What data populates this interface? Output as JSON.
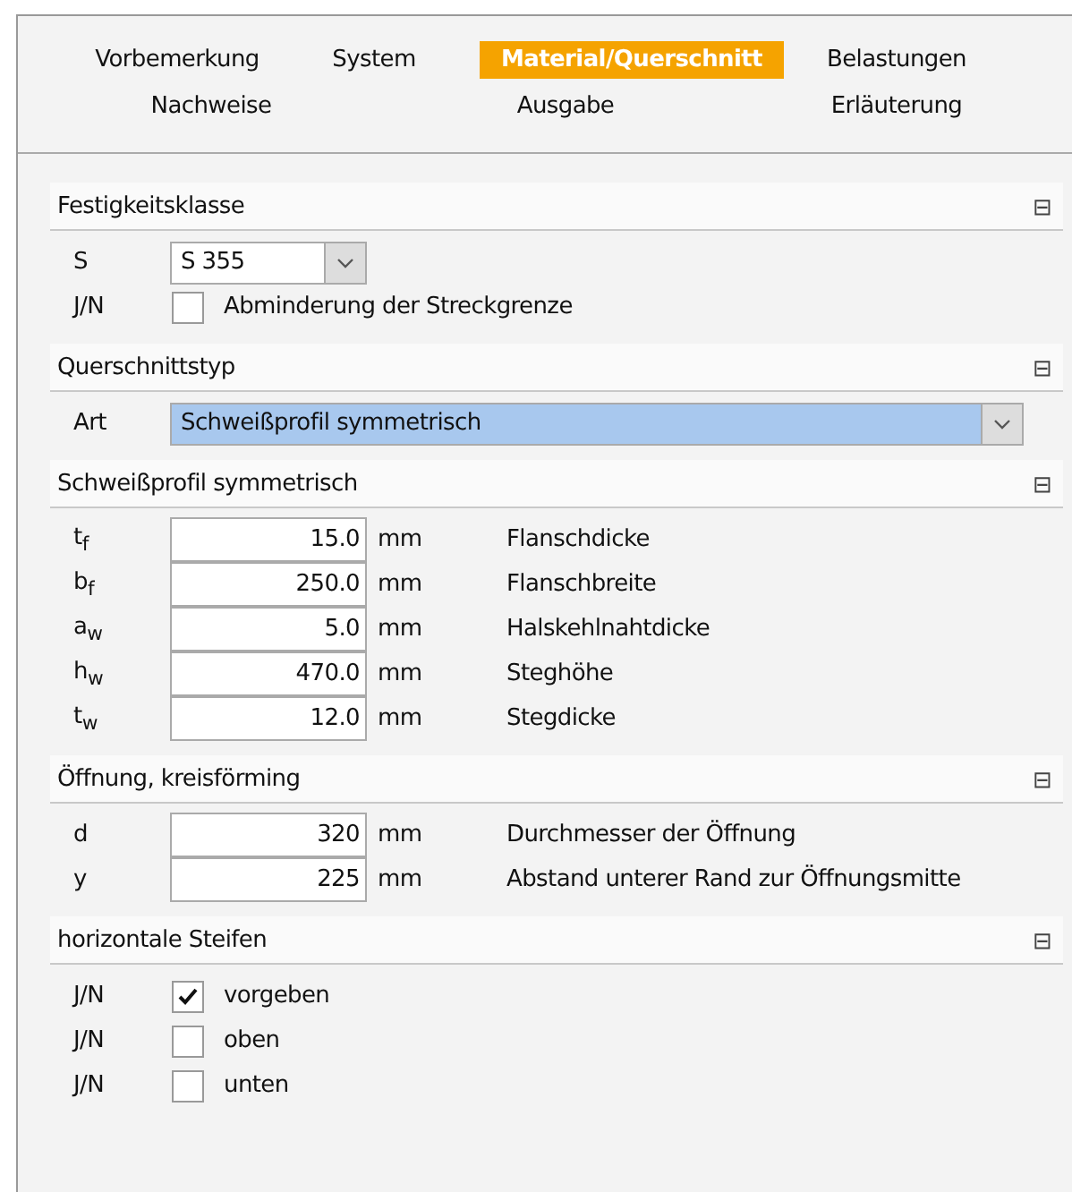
{
  "tabs": [
    [
      {
        "label": "Vorbemerkung",
        "selected": false
      },
      {
        "label": "System",
        "selected": false
      },
      {
        "label": "Material/Querschnitt",
        "selected": true
      },
      {
        "label": "Belastungen",
        "selected": false
      }
    ],
    [
      {
        "label": "Nachweise",
        "selected": false
      },
      {
        "label": "Ausgabe",
        "selected": false
      },
      {
        "label": "Erläuterung",
        "selected": false
      }
    ]
  ],
  "sections": [
    {
      "title": "Festigkeitsklasse",
      "collapse_icon": "⊟",
      "rows": [
        {
          "kind": "select",
          "label": "S",
          "value": "S 355",
          "wide": false
        },
        {
          "kind": "checkbox",
          "label": "J/N",
          "checked": false,
          "text": "Abminderung der Streckgrenze"
        }
      ]
    },
    {
      "title": "Querschnittstyp",
      "collapse_icon": "⊟",
      "rows": [
        {
          "kind": "select",
          "label": "Art",
          "value": "Schweißprofil symmetrisch",
          "wide": true
        }
      ]
    },
    {
      "title": "Schweißprofil symmetrisch",
      "collapse_icon": "⊟",
      "rows": [
        {
          "kind": "number",
          "label": "t$_{f}$",
          "value": "15.0",
          "unit": "mm",
          "text": "Flanschdicke"
        },
        {
          "kind": "number",
          "label": "b$_{f}$",
          "value": "250.0",
          "unit": "mm",
          "text": "Flanschbreite"
        },
        {
          "kind": "number",
          "label": "a$_{w}$",
          "value": "5.0",
          "unit": "mm",
          "text": "Halskehlnahtdicke"
        },
        {
          "kind": "number",
          "label": "h$_{w}$",
          "value": "470.0",
          "unit": "mm",
          "text": "Steghöhe"
        },
        {
          "kind": "number",
          "label": "t$_{w}$",
          "value": "12.0",
          "unit": "mm",
          "text": "Stegdicke"
        }
      ]
    },
    {
      "title": "Öffnung, kreisförming",
      "collapse_icon": "⊟",
      "rows": [
        {
          "kind": "number",
          "label": "d",
          "value": "320",
          "unit": "mm",
          "text": "Durchmesser der Öffnung"
        },
        {
          "kind": "number",
          "label": "y",
          "value": "225",
          "unit": "mm",
          "text": "Abstand unterer Rand zur Öffnungsmitte"
        }
      ]
    },
    {
      "title": "horizontale Steifen",
      "collapse_icon": "⊟",
      "rows": [
        {
          "kind": "checkbox",
          "label": "J/N",
          "checked": true,
          "text": "vorgeben"
        },
        {
          "kind": "checkbox",
          "label": "J/N",
          "checked": false,
          "text": "oben"
        },
        {
          "kind": "checkbox",
          "label": "J/N",
          "checked": false,
          "text": "unten"
        }
      ]
    }
  ]
}
